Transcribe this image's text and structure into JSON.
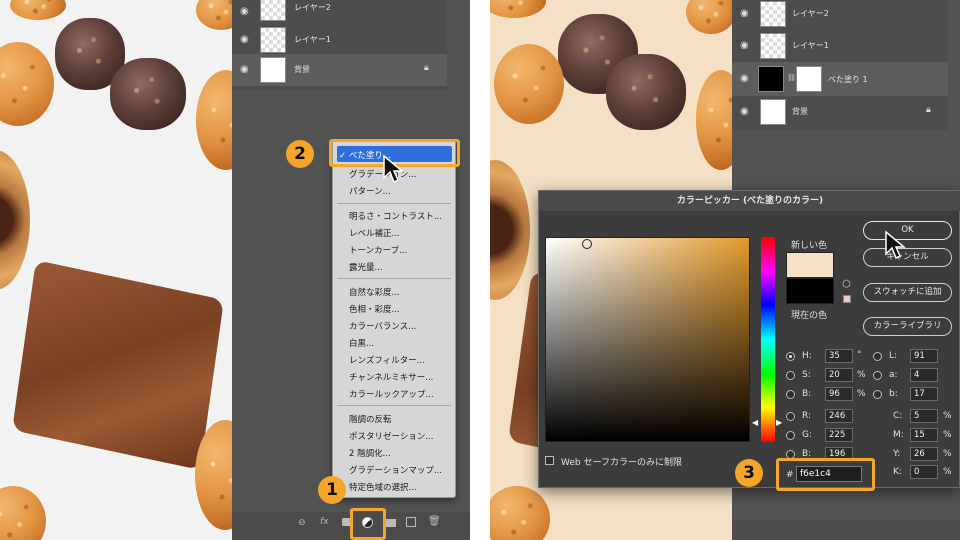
{
  "left": {
    "layers": [
      {
        "name": "レイヤー2"
      },
      {
        "name": "レイヤー1"
      },
      {
        "name": "背景"
      }
    ],
    "adjustment_menu": [
      {
        "label": "✓ べた塗り..."
      },
      {
        "label": "グラデーション..."
      },
      {
        "label": "パターン..."
      },
      {
        "label": "明るさ・コントラスト..."
      },
      {
        "label": "レベル補正..."
      },
      {
        "label": "トーンカーブ..."
      },
      {
        "label": "露光量..."
      },
      {
        "label": "自然な彩度..."
      },
      {
        "label": "色相・彩度..."
      },
      {
        "label": "カラーバランス..."
      },
      {
        "label": "白黒..."
      },
      {
        "label": "レンズフィルター..."
      },
      {
        "label": "チャンネルミキサー..."
      },
      {
        "label": "カラールックアップ..."
      },
      {
        "label": "階調の反転"
      },
      {
        "label": "ポスタリゼーション..."
      },
      {
        "label": "2 階調化..."
      },
      {
        "label": "グラデーションマップ..."
      },
      {
        "label": "特定色域の選択..."
      }
    ],
    "badges": {
      "one": "1",
      "two": "2"
    },
    "toolbar": {
      "link": "⊖",
      "fx": "fx"
    }
  },
  "right": {
    "layers": [
      {
        "name": "レイヤー2"
      },
      {
        "name": "レイヤー1"
      },
      {
        "name": "べた塗り 1"
      },
      {
        "name": "背景"
      }
    ],
    "picker": {
      "title": "カラーピッカー (べた塗りのカラー)",
      "new_color_label": "新しい色",
      "current_color_label": "現在の色",
      "new_color": "#f6e1c4",
      "current_color": "#000000",
      "buttons": {
        "ok": "OK",
        "cancel": "キャンセル",
        "add_swatch": "スウォッチに追加",
        "library": "カラーライブラリ"
      },
      "web_safe_label": "Web セーフカラーのみに制限",
      "hsb": {
        "h": "35",
        "s": "20",
        "b": "96"
      },
      "rgb": {
        "r": "246",
        "g": "225",
        "b": "196"
      },
      "lab": {
        "l": "91",
        "a": "4",
        "b": "17"
      },
      "cmyk": {
        "c": "5",
        "m": "15",
        "y": "26",
        "k": "0"
      },
      "units": {
        "deg": "°",
        "pct": "%"
      },
      "hex_label": "#",
      "hex_value": "f6e1c4"
    },
    "badges": {
      "three": "3"
    }
  }
}
